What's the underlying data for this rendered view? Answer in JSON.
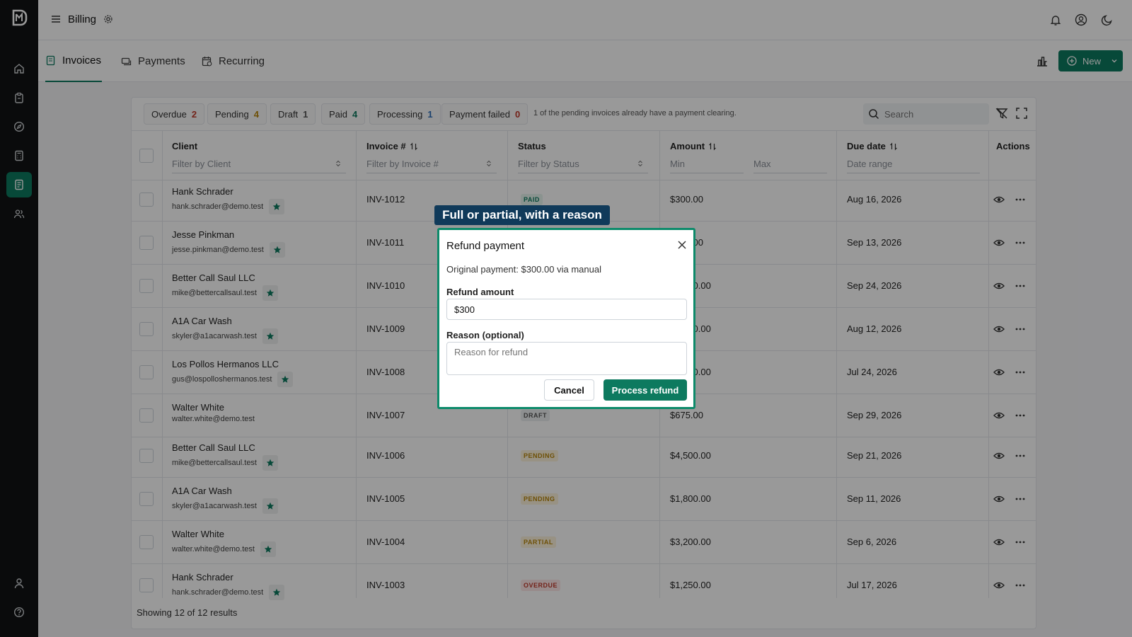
{
  "header": {
    "title": "Billing"
  },
  "tabs": [
    {
      "label": "Invoices",
      "icon": "invoice-icon",
      "active": true
    },
    {
      "label": "Payments",
      "icon": "payments-icon",
      "active": false
    },
    {
      "label": "Recurring",
      "icon": "recurring-icon",
      "active": false
    }
  ],
  "toolbar": {
    "new_label": "New"
  },
  "filters": {
    "chips": [
      {
        "label": "Overdue",
        "count": "2"
      },
      {
        "label": "Pending",
        "count": "4"
      },
      {
        "label": "Draft",
        "count": "1"
      },
      {
        "label": "Paid",
        "count": "4"
      },
      {
        "label": "Processing",
        "count": "1"
      },
      {
        "label": "Payment failed",
        "count": "0"
      }
    ],
    "note": "1 of the pending invoices already have a payment clearing.",
    "search_placeholder": "Search"
  },
  "table": {
    "headers": {
      "client": "Client",
      "invoice": "Invoice #",
      "status": "Status",
      "amount": "Amount",
      "due": "Due date",
      "actions": "Actions"
    },
    "filters": {
      "client": "Filter by Client",
      "invoice": "Filter by Invoice #",
      "status": "Filter by Status",
      "min": "Min",
      "max": "Max",
      "due": "Date range"
    },
    "rows": [
      {
        "name": "Hank Schrader",
        "email": "hank.schrader@demo.test",
        "invoice": "INV-1012",
        "status": "PAID",
        "amount": "$300.00",
        "due": "Aug 16, 2026",
        "starred": true
      },
      {
        "name": "Jesse Pinkman",
        "email": "jesse.pinkman@demo.test",
        "invoice": "INV-1011",
        "status": "",
        "amount": "$675.00",
        "due": "Sep 13, 2026",
        "starred": true
      },
      {
        "name": "Better Call Saul LLC",
        "email": "mike@bettercallsaul.test",
        "invoice": "INV-1010",
        "status": "",
        "amount": "$4,500.00",
        "due": "Sep 24, 2026",
        "starred": true
      },
      {
        "name": "A1A Car Wash",
        "email": "skyler@a1acarwash.test",
        "invoice": "INV-1009",
        "status": "",
        "amount": "$1,800.00",
        "due": "Aug 12, 2026",
        "starred": true
      },
      {
        "name": "Los Pollos Hermanos LLC",
        "email": "gus@lospolloshermanos.test",
        "invoice": "INV-1008",
        "status": "",
        "amount": "$3,200.00",
        "due": "Jul 24, 2026",
        "starred": true
      },
      {
        "name": "Walter White",
        "email": "walter.white@demo.test",
        "invoice": "INV-1007",
        "status": "DRAFT",
        "amount": "$675.00",
        "due": "Sep 29, 2026",
        "starred": false
      },
      {
        "name": "Better Call Saul LLC",
        "email": "mike@bettercallsaul.test",
        "invoice": "INV-1006",
        "status": "PENDING",
        "amount": "$4,500.00",
        "due": "Sep 21, 2026",
        "starred": true
      },
      {
        "name": "A1A Car Wash",
        "email": "skyler@a1acarwash.test",
        "invoice": "INV-1005",
        "status": "PENDING",
        "amount": "$1,800.00",
        "due": "Sep 11, 2026",
        "starred": true
      },
      {
        "name": "Walter White",
        "email": "walter.white@demo.test",
        "invoice": "INV-1004",
        "status": "PARTIAL",
        "amount": "$3,200.00",
        "due": "Sep 6, 2026",
        "starred": true
      },
      {
        "name": "Hank Schrader",
        "email": "hank.schrader@demo.test",
        "invoice": "INV-1003",
        "status": "OVERDUE",
        "amount": "$1,250.00",
        "due": "Jul 17, 2026",
        "starred": true
      }
    ],
    "footer": "Showing 12 of 12 results"
  },
  "tooltip": "Full or partial, with a reason",
  "modal": {
    "title": "Refund payment",
    "original": "Original payment: $300.00 via manual",
    "amount_label": "Refund amount",
    "amount_value": "$300",
    "reason_label": "Reason (optional)",
    "reason_placeholder": "Reason for refund",
    "cancel_label": "Cancel",
    "submit_label": "Process refund"
  },
  "colors": {
    "accent": "#0d7a5f",
    "sidebar": "#111315",
    "tooltip": "#103a5a"
  }
}
